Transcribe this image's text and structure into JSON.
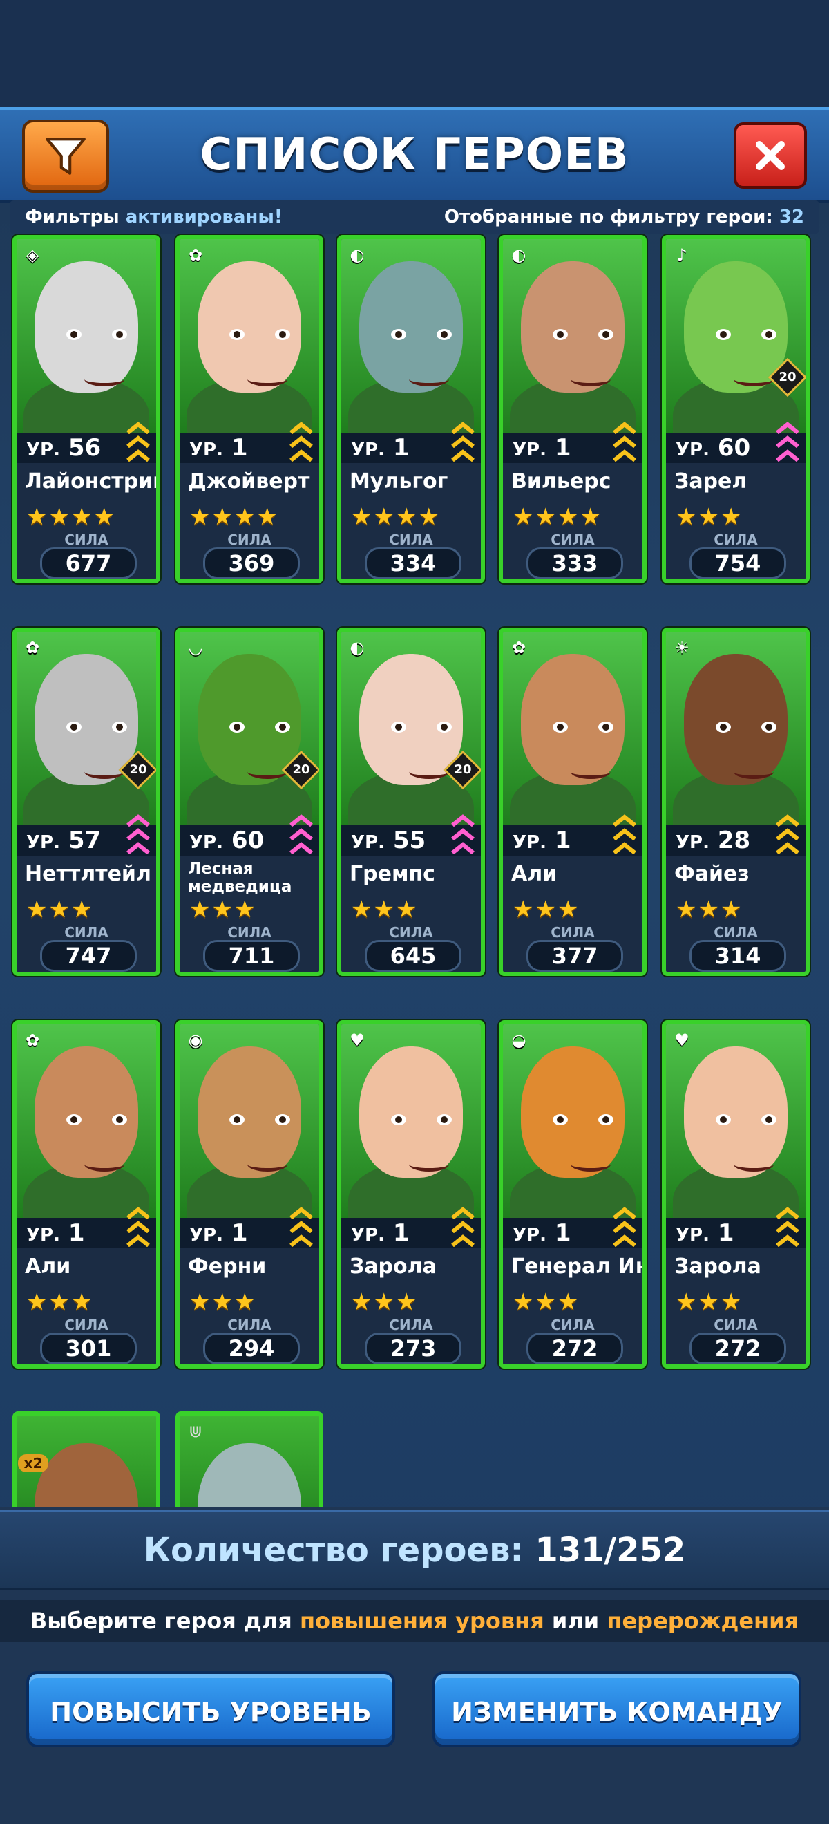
{
  "header": {
    "title": "СПИСОК ГЕРОЕВ",
    "filter_icon": "filter-funnel-icon",
    "close_icon": "close-x-icon"
  },
  "filterbar": {
    "left_prefix": "Фильтры",
    "left_status": "активированы!",
    "right_label": "Отобранные по фильтру герои:",
    "right_count": "32"
  },
  "heroes": [
    {
      "level_prefix": "УР.",
      "level": "56",
      "name": "Лайонстринг",
      "stars": "★★★★",
      "power_label": "СИЛА",
      "power": "677",
      "limit": "",
      "rank_color": "#f7c21a",
      "skin": "#d9d9d9",
      "bg": "#4fc44a",
      "element_icon": "ring-icon",
      "element_badge": "◈"
    },
    {
      "level_prefix": "УР.",
      "level": "1",
      "name": "Джойверт",
      "stars": "★★★★",
      "power_label": "СИЛА",
      "power": "369",
      "limit": "",
      "rank_color": "#f7c21a",
      "skin": "#f0c8b0",
      "bg": "#4fc44a",
      "element_icon": "butterfly-icon",
      "element_badge": "✿"
    },
    {
      "level_prefix": "УР.",
      "level": "1",
      "name": "Мульгог",
      "stars": "★★★★",
      "power_label": "СИЛА",
      "power": "334",
      "limit": "",
      "rank_color": "#f7c21a",
      "skin": "#7aa3a3",
      "bg": "#4fc44a",
      "element_icon": "mask-icon",
      "element_badge": "◐"
    },
    {
      "level_prefix": "УР.",
      "level": "1",
      "name": "Вильерс",
      "stars": "★★★★",
      "power_label": "СИЛА",
      "power": "333",
      "limit": "",
      "rank_color": "#f7c21a",
      "skin": "#c99370",
      "bg": "#4fc44a",
      "element_icon": "hat-icon",
      "element_badge": "◐"
    },
    {
      "level_prefix": "УР.",
      "level": "60",
      "name": "Зарел",
      "stars": "★★★",
      "power_label": "СИЛА",
      "power": "754",
      "limit": "20",
      "rank_color": "#ff5fd0",
      "skin": "#78c850",
      "bg": "#4fc44a",
      "element_icon": "shield-icon",
      "element_badge": "♪"
    },
    {
      "level_prefix": "УР.",
      "level": "57",
      "name": "Неттлтейл",
      "stars": "★★★",
      "power_label": "СИЛА",
      "power": "747",
      "limit": "20",
      "rank_color": "#ff5fd0",
      "skin": "#bfbfbf",
      "bg": "#4fc44a",
      "element_icon": "leaf-icon",
      "element_badge": "✿"
    },
    {
      "level_prefix": "УР.",
      "level": "60",
      "name": "Лесная медведица",
      "stars": "★★★",
      "power_label": "СИЛА",
      "power": "711",
      "limit": "20",
      "rank_color": "#ff5fd0",
      "skin": "#4f9a2c",
      "bg": "#4fc44a",
      "element_icon": "hand-icon",
      "element_badge": "◡"
    },
    {
      "level_prefix": "УР.",
      "level": "55",
      "name": "Гремпс",
      "stars": "★★★",
      "power_label": "СИЛА",
      "power": "645",
      "limit": "20",
      "rank_color": "#ff5fd0",
      "skin": "#f0d0c0",
      "bg": "#4fc44a",
      "element_icon": "leaf-icon",
      "element_badge": "◐"
    },
    {
      "level_prefix": "УР.",
      "level": "1",
      "name": "Али",
      "stars": "★★★",
      "power_label": "СИЛА",
      "power": "377",
      "limit": "",
      "rank_color": "#f7c21a",
      "skin": "#c98a5c",
      "bg": "#4fc44a",
      "element_icon": "flower-icon",
      "element_badge": "✿"
    },
    {
      "level_prefix": "УР.",
      "level": "28",
      "name": "Файез",
      "stars": "★★★",
      "power_label": "СИЛА",
      "power": "314",
      "limit": "",
      "rank_color": "#f7c21a",
      "skin": "#7b4a2c",
      "bg": "#4fc44a",
      "element_icon": "sun-icon",
      "element_badge": "☀"
    },
    {
      "level_prefix": "УР.",
      "level": "1",
      "name": "Али",
      "stars": "★★★",
      "power_label": "СИЛА",
      "power": "301",
      "limit": "",
      "rank_color": "#f7c21a",
      "skin": "#c98a5c",
      "bg": "#4fc44a",
      "element_icon": "flower-icon",
      "element_badge": "✿"
    },
    {
      "level_prefix": "УР.",
      "level": "1",
      "name": "Ферни",
      "stars": "★★★",
      "power_label": "СИЛА",
      "power": "294",
      "limit": "",
      "rank_color": "#f7c21a",
      "skin": "#c9915a",
      "bg": "#4fc44a",
      "element_icon": "tiger-icon",
      "element_badge": "◉"
    },
    {
      "level_prefix": "УР.",
      "level": "1",
      "name": "Зарола",
      "stars": "★★★",
      "power_label": "СИЛА",
      "power": "273",
      "limit": "",
      "rank_color": "#f7c21a",
      "skin": "#f0c0a0",
      "bg": "#4fc44a",
      "element_icon": "heart-icon",
      "element_badge": "♥"
    },
    {
      "level_prefix": "УР.",
      "level": "1",
      "name": "Генерал Инь",
      "stars": "★★★",
      "power_label": "СИЛА",
      "power": "272",
      "limit": "",
      "rank_color": "#f7c21a",
      "skin": "#e08a30",
      "bg": "#4fc44a",
      "element_icon": "hat-icon",
      "element_badge": "◒"
    },
    {
      "level_prefix": "УР.",
      "level": "1",
      "name": "Зарола",
      "stars": "★★★",
      "power_label": "СИЛА",
      "power": "272",
      "limit": "",
      "rank_color": "#f7c21a",
      "skin": "#f0c0a0",
      "bg": "#4fc44a",
      "element_icon": "heart-icon",
      "element_badge": "♥"
    }
  ],
  "partial_heroes": [
    {
      "badge": "x2",
      "skin": "#a0643c",
      "element_icon": "double-xp-icon"
    },
    {
      "badge": "",
      "skin": "#9fb8b8",
      "element_icon": "claw-icon"
    }
  ],
  "footer": {
    "count_label": "Количество героев:",
    "count_value": "131/252",
    "hint_prefix": "Выберите героя для",
    "hint_levelup": "повышения уровня",
    "hint_or": "или",
    "hint_rebirth": "перерождения",
    "btn_levelup": "ПОВЫСИТЬ УРОВЕНЬ",
    "btn_team": "ИЗМЕНИТЬ КОМАНДУ"
  }
}
